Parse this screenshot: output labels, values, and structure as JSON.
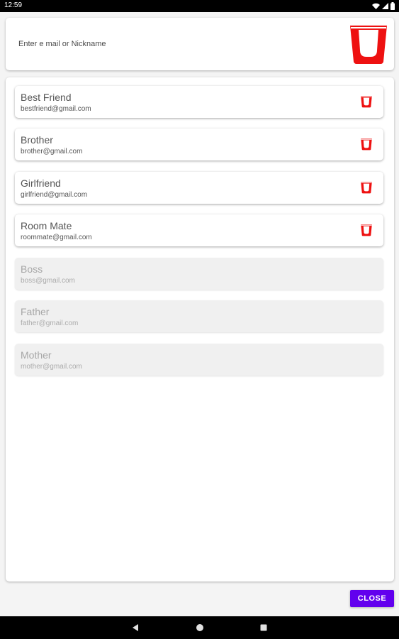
{
  "status_bar": {
    "time": "12:59",
    "icons": [
      "wifi-icon",
      "signal-icon",
      "battery-icon"
    ]
  },
  "search": {
    "placeholder": "Enter e mail or Nickname",
    "value": "",
    "icon": "cup-icon"
  },
  "contacts": [
    {
      "name": "Best Friend",
      "email": "bestfriend@gmail.com",
      "active": true
    },
    {
      "name": "Brother",
      "email": "brother@gmail.com",
      "active": true
    },
    {
      "name": "Girlfriend",
      "email": "girlfriend@gmail.com",
      "active": true
    },
    {
      "name": "Room Mate",
      "email": "roommate@gmail.com",
      "active": true
    },
    {
      "name": "Boss",
      "email": "boss@gmail.com",
      "active": false
    },
    {
      "name": "Father",
      "email": "father@gmail.com",
      "active": false
    },
    {
      "name": "Mother",
      "email": "mother@gmail.com",
      "active": false
    }
  ],
  "actions": {
    "close_label": "CLOSE"
  },
  "nav_bar": {
    "icons": [
      "back-icon",
      "home-icon",
      "recents-icon"
    ]
  },
  "colors": {
    "accent": "#6200ee",
    "cup_red": "#ee1111"
  }
}
